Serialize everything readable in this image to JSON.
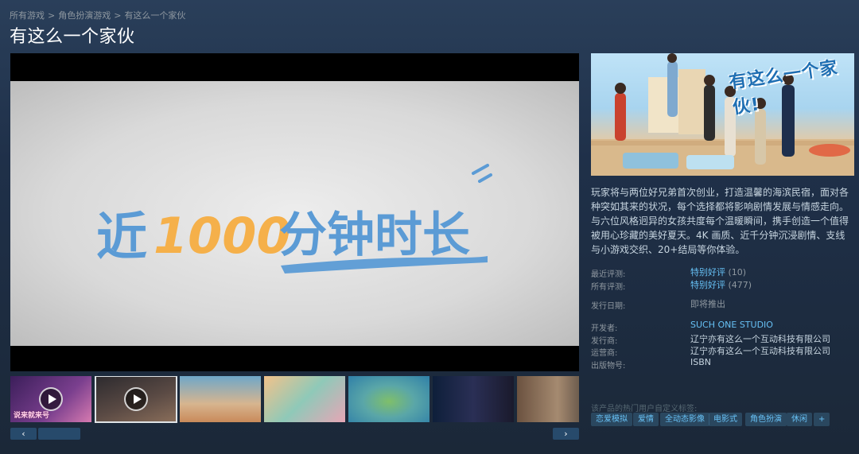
{
  "breadcrumb": [
    "所有游戏",
    "角色扮演游戏",
    "有这么一个家伙"
  ],
  "breadcrumb_sep": ">",
  "title": "有这么一个家伙",
  "video": {
    "banner_text_prefix": "近",
    "banner_text_number": "1000",
    "banner_text_suffix": "分钟时长"
  },
  "thumbnails": [
    {
      "type": "video",
      "caption": "说来就来号",
      "active": false
    },
    {
      "type": "video",
      "caption": "",
      "active": true
    },
    {
      "type": "image",
      "caption": "",
      "active": false
    },
    {
      "type": "image",
      "caption": "",
      "active": false
    },
    {
      "type": "image",
      "caption": "",
      "active": false
    },
    {
      "type": "image",
      "caption": "",
      "active": false
    },
    {
      "type": "image",
      "caption": "",
      "active": false
    }
  ],
  "nav": {
    "prev": "‹",
    "next": "›"
  },
  "capsule": {
    "logo_text": "有这么一个家伙!"
  },
  "description": "玩家将与两位好兄弟首次创业，打造温馨的海滨民宿，面对各种突如其来的状况，每个选择都将影响剧情发展与情感走向。与六位风格迥异的女孩共度每个温暖瞬间，携手创造一个值得被用心珍藏的美好夏天。4K 画质、近千分钟沉浸剧情、支线与小游戏交织、20+结局等你体验。",
  "reviews": {
    "recent_label": "最近评测:",
    "recent_summary": "特别好评",
    "recent_count": "(10)",
    "all_label": "所有评测:",
    "all_summary": "特别好评",
    "all_count": "(477)"
  },
  "release": {
    "label": "发行日期:",
    "value": "即将推出"
  },
  "developer": {
    "label": "开发者:",
    "value": "SUCH ONE STUDIO"
  },
  "publisher": {
    "label": "发行商:",
    "value": "辽宁亦有这么一个互动科技有限公司"
  },
  "operator": {
    "label": "运营商:",
    "value": "辽宁亦有这么一个互动科技有限公司"
  },
  "isbn": {
    "label": "出版物号:",
    "value": "ISBN"
  },
  "tags_label": "该产品的热门用户自定义标签:",
  "tags": [
    "恋爱模拟",
    "爱情",
    "全动态影像",
    "电影式",
    "角色扮演",
    "休闲",
    "+"
  ],
  "colors": {
    "accent": "#66c0f4",
    "bg": "#1b2838",
    "tag_bg": "#67c1f533"
  }
}
